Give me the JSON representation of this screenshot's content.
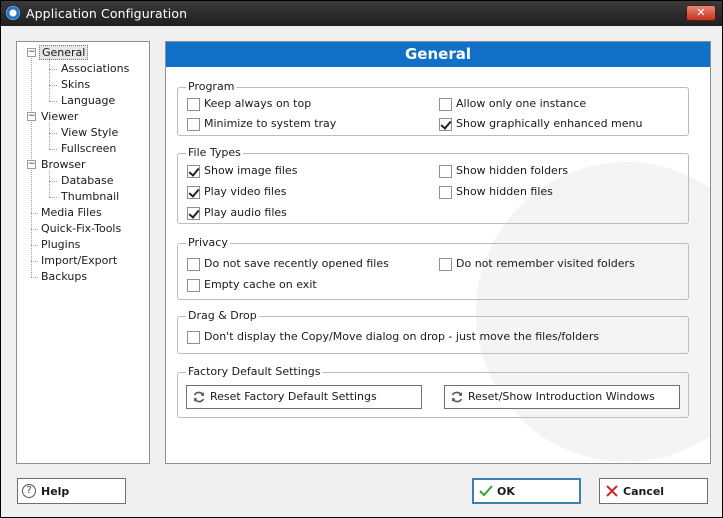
{
  "window": {
    "title": "Application Configuration",
    "close_glyph": "✕"
  },
  "tree": [
    {
      "label": "General",
      "level": 0,
      "expander": "−",
      "selected": true
    },
    {
      "label": "Associations",
      "level": 1
    },
    {
      "label": "Skins",
      "level": 1
    },
    {
      "label": "Language",
      "level": 1
    },
    {
      "label": "Viewer",
      "level": 0,
      "expander": "−"
    },
    {
      "label": "View Style",
      "level": 1
    },
    {
      "label": "Fullscreen",
      "level": 1
    },
    {
      "label": "Browser",
      "level": 0,
      "expander": "−"
    },
    {
      "label": "Database",
      "level": 1
    },
    {
      "label": "Thumbnail",
      "level": 1
    },
    {
      "label": "Media Files",
      "level": 0
    },
    {
      "label": "Quick-Fix-Tools",
      "level": 0
    },
    {
      "label": "Plugins",
      "level": 0
    },
    {
      "label": "Import/Export",
      "level": 0
    },
    {
      "label": "Backups",
      "level": 0
    }
  ],
  "panel": {
    "header": "General",
    "groups": {
      "program": {
        "title": "Program",
        "items": [
          {
            "label": "Keep always on top",
            "checked": false
          },
          {
            "label": "Allow only one instance",
            "checked": false
          },
          {
            "label": "Minimize to system tray",
            "checked": false
          },
          {
            "label": "Show graphically enhanced menu",
            "checked": true
          }
        ]
      },
      "file_types": {
        "title": "File Types",
        "items": [
          {
            "label": "Show image files",
            "checked": true
          },
          {
            "label": "Show hidden folders",
            "checked": false
          },
          {
            "label": "Play video files",
            "checked": true
          },
          {
            "label": "Show hidden files",
            "checked": false
          },
          {
            "label": "Play audio files",
            "checked": true
          }
        ]
      },
      "privacy": {
        "title": "Privacy",
        "items": [
          {
            "label": "Do not save recently opened files",
            "checked": false
          },
          {
            "label": "Do not remember visited folders",
            "checked": false
          },
          {
            "label": "Empty cache on exit",
            "checked": false
          }
        ]
      },
      "drag_drop": {
        "title": "Drag & Drop",
        "items": [
          {
            "label": "Don't display the Copy/Move dialog on drop - just move the files/folders",
            "checked": false
          }
        ]
      },
      "factory": {
        "title": "Factory Default Settings",
        "reset_label": "Reset Factory Default Settings",
        "intro_label": "Reset/Show Introduction Windows"
      }
    }
  },
  "footer": {
    "help_label": "Help",
    "ok_label": "OK",
    "cancel_label": "Cancel"
  },
  "colors": {
    "header_blue": "#1170c7",
    "ok_check": "#3aa03a",
    "cancel_x": "#c92a2a"
  }
}
